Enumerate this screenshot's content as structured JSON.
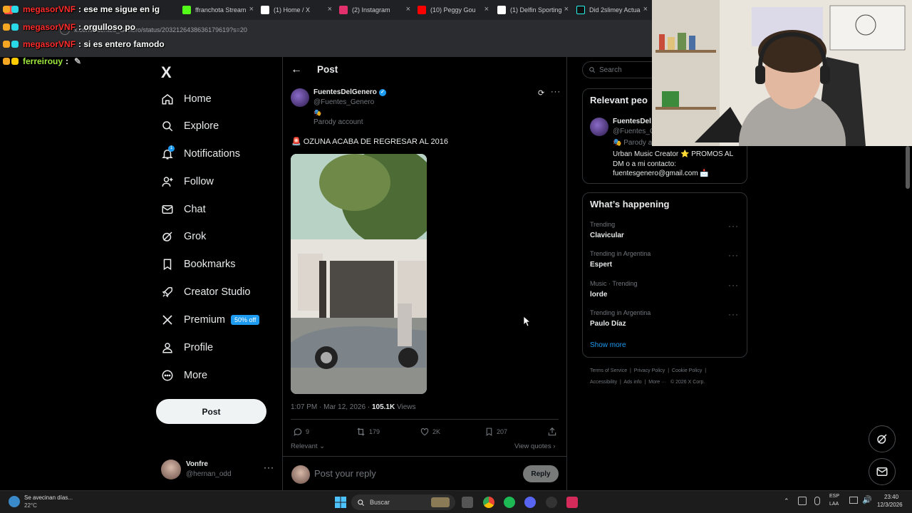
{
  "browser": {
    "tabs": [
      {
        "title": "",
        "color": "#ff4444"
      },
      {
        "title": "ffranchota Stream",
        "color": "#53fc18"
      },
      {
        "title": "(1) Home / X",
        "color": "#ffffff"
      },
      {
        "title": "(2) Instagram",
        "color": "#e1306c"
      },
      {
        "title": "(10) Peggy Gou",
        "color": "#ff0000"
      },
      {
        "title": "(1) Delfin Sporting",
        "color": "#ffffff"
      },
      {
        "title": "Did 2slimey Actua",
        "color": "#ffffff"
      }
    ],
    "url": "x.com/Fuentes_Genero/status/2032126438636179619?s=20"
  },
  "chat": [
    {
      "user": "megasorVNF",
      "message": ": ese me sigue en ig"
    },
    {
      "user": "megasorVNF",
      "message": ": orgulloso po"
    },
    {
      "user": "megasorVNF",
      "message": ": si es entero famodo"
    },
    {
      "user": "ferreirouy",
      "message": ":"
    }
  ],
  "nav": {
    "logo": "X",
    "items": [
      {
        "label": "Home",
        "icon": "home-icon"
      },
      {
        "label": "Explore",
        "icon": "search-icon"
      },
      {
        "label": "Notifications",
        "icon": "bell-icon",
        "badge": "1"
      },
      {
        "label": "Follow",
        "icon": "follow-icon"
      },
      {
        "label": "Chat",
        "icon": "mail-icon"
      },
      {
        "label": "Grok",
        "icon": "grok-icon"
      },
      {
        "label": "Bookmarks",
        "icon": "bookmark-icon"
      },
      {
        "label": "Creator Studio",
        "icon": "rocket-icon"
      },
      {
        "label": "Premium",
        "icon": "x-icon",
        "badge": "50% off"
      },
      {
        "label": "Profile",
        "icon": "person-icon"
      },
      {
        "label": "More",
        "icon": "more-circle-icon"
      }
    ],
    "post_label": "Post",
    "account": {
      "name": "Vonfre",
      "handle": "@hernan_odd"
    }
  },
  "post": {
    "header_title": "Post",
    "author_name": "FuentesDelGenero",
    "author_handle": "@Fuentes_Genero",
    "author_emoji": "🎭",
    "parody_label": "Parody account",
    "text": "🚨 OZUNA ACABA DE REGRESAR AL 2016",
    "timestamp": "1:07 PM · Mar 12, 2026 ·",
    "views_count": "105.1K",
    "views_label": "Views",
    "replies": "9",
    "reposts": "179",
    "likes": "2K",
    "bookmarks": "207",
    "sort_label": "Relevant",
    "view_quotes": "View quotes",
    "reply_placeholder": "Post your reply",
    "reply_button": "Reply"
  },
  "right": {
    "search_placeholder": "Search",
    "relevant_title": "Relevant peo",
    "relevant_name": "FuentesDel",
    "relevant_handle": "@Fuentes_G",
    "relevant_parody": "🎭 Parody a",
    "relevant_bio": "Urban Music Creator ⭐ PROMOS AL DM o a mi contacto: fuentesgenero@gmail.com 📩",
    "happening_title": "What’s happening",
    "trends": [
      {
        "meta": "Trending",
        "name": "Clavicular"
      },
      {
        "meta": "Trending in Argentina",
        "name": "Espert"
      },
      {
        "meta": "Music · Trending",
        "name": "lorde"
      },
      {
        "meta": "Trending in Argentina",
        "name": "Paulo Díaz"
      }
    ],
    "show_more": "Show more",
    "footer_line1": [
      "Terms of Service",
      "Privacy Policy",
      "Cookie Policy"
    ],
    "footer_line2": [
      "Accessibility",
      "Ads info",
      "More ···",
      "© 2026 X Corp."
    ]
  },
  "taskbar": {
    "weather_text": "Se avecinan días...",
    "weather_temp": "22°C",
    "search_placeholder": "Buscar",
    "lang_top": "ESP",
    "lang_bottom": "LAA",
    "time": "23:40",
    "date": "12/3/2026"
  },
  "colors": {
    "accent": "#1d9bf0",
    "bg": "#000000",
    "border": "#2f3336",
    "muted": "#71767b"
  }
}
